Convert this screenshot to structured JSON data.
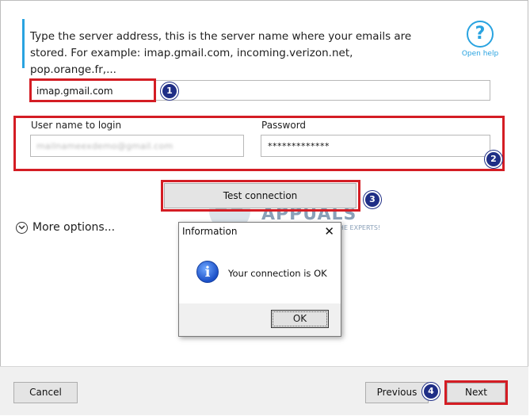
{
  "server": {
    "instructions": "Type the server address, this is the server name where your emails are stored. For example: imap.gmail.com, incoming.verizon.net, pop.orange.fr,...",
    "value": "imap.gmail.com",
    "badge": "1"
  },
  "help": {
    "icon": "question-circle-icon",
    "label": "Open help"
  },
  "credentials": {
    "username_label": "User name to login",
    "username_value": "mailnameexdemo@gmail.com",
    "password_label": "Password",
    "password_value": "*************",
    "badge": "2"
  },
  "test": {
    "label": "Test connection",
    "badge": "3"
  },
  "more_options": {
    "label": "More options..."
  },
  "watermark": {
    "title": "APPUALS",
    "subtitle": "TECH HOW-TO'S FROM THE EXPERTS!"
  },
  "dialog": {
    "title": "Information",
    "close": "✕",
    "icon": "information-icon",
    "icon_glyph": "i",
    "message": "Your connection is OK",
    "ok": "OK"
  },
  "footer": {
    "cancel": "Cancel",
    "previous": "Previous",
    "next": "Next",
    "badge": "4"
  },
  "colors": {
    "accent": "#29a3e0",
    "highlight": "#d41d24",
    "badge": "#1f2e86"
  }
}
